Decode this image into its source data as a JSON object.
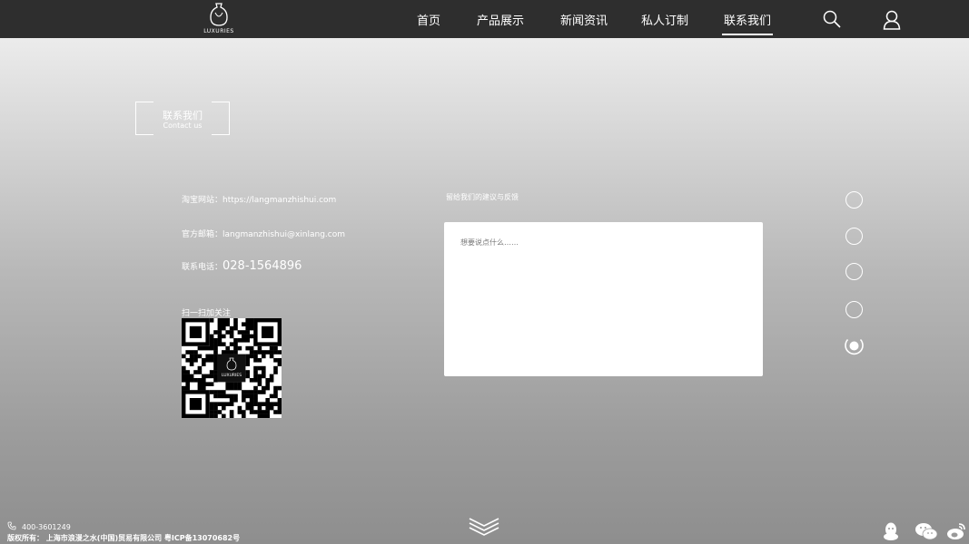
{
  "brand": {
    "logo_text": "LUXURIES"
  },
  "nav": {
    "items": [
      {
        "label": "首页"
      },
      {
        "label": "产品展示"
      },
      {
        "label": "新闻资讯"
      },
      {
        "label": "私人订制"
      },
      {
        "label": "联系我们",
        "active": true
      }
    ],
    "icons": [
      "search-icon",
      "user-icon"
    ]
  },
  "contact_header": {
    "title": "联系我们",
    "subtitle": "Contact us"
  },
  "info": {
    "taobao_label": "淘宝网站：",
    "taobao_value": "https://langmanzhishui.com",
    "email_label": "官方邮箱：",
    "email_value": "langmanzhishui@xinlang.com",
    "phone_label": "联系电话：",
    "phone_value": "028-1564896"
  },
  "qr": {
    "label": "扫一扫加关注",
    "logo_text": "LUXURIES"
  },
  "feedback": {
    "label": "留给我们的建议与反馈",
    "placeholder": "想要说点什么……"
  },
  "pager": {
    "count": 5,
    "active_index": 4
  },
  "footer": {
    "phone": "400-3601249",
    "copyright": "版权所有：  上海市浪漫之水(中国)贸易有限公司 粤ICP备13070682号"
  },
  "social_icons": [
    "qq-icon",
    "wechat-icon",
    "weibo-icon"
  ],
  "colors": {
    "topbar": "#2e2e2e",
    "text": "#ffffff",
    "background_top": "#f4f4f4",
    "background_bottom": "#8e8e8e"
  }
}
